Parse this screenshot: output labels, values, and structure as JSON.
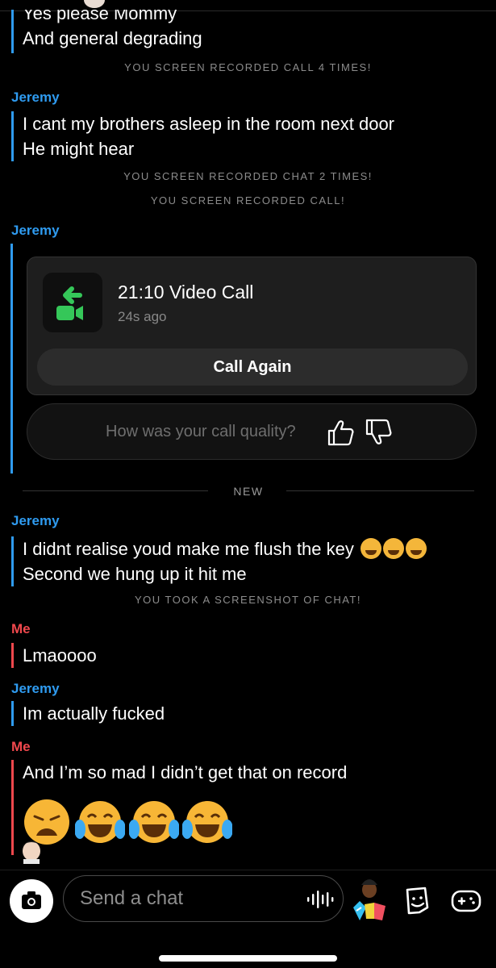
{
  "messages_top": {
    "cut_line": "Yes please Mommy",
    "line2": "And general degrading"
  },
  "system": {
    "rec_call_4": "YOU SCREEN RECORDED CALL 4 TIMES!",
    "rec_chat_2": "YOU SCREEN RECORDED CHAT 2 TIMES!",
    "rec_call": "YOU SCREEN RECORDED CALL!",
    "screenshot": "YOU TOOK A SCREENSHOT OF CHAT!",
    "new": "NEW"
  },
  "senders": {
    "jeremy": "Jeremy",
    "me": "Me"
  },
  "jeremy_msg1": {
    "line1": "I cant my brothers asleep in the room next door",
    "line2": "He might hear"
  },
  "call_card": {
    "title": "21:10 Video Call",
    "time": "24s ago",
    "call_again": "Call Again",
    "quality_prompt": "How was your call quality?"
  },
  "jeremy_msg2": {
    "line1": "I didnt realise youd make me flush the key",
    "line2": "Second we hung up it hit me"
  },
  "me_msg1": {
    "line1": "Lmaoooo"
  },
  "jeremy_msg3": {
    "line1": "Im actually fucked"
  },
  "me_msg2": {
    "line1": "And I’m so mad I didn’t get that on record"
  },
  "composer": {
    "placeholder": "Send a chat"
  },
  "colors": {
    "jeremy": "#2f9bf0",
    "me": "#f0484d",
    "call_green": "#35c759"
  },
  "icons": [
    "camera-icon",
    "microphone-icon",
    "bitmoji-icon",
    "sticker-icon",
    "game-controller-icon",
    "thumbs-up-icon",
    "thumbs-down-icon",
    "video-call-icon"
  ]
}
